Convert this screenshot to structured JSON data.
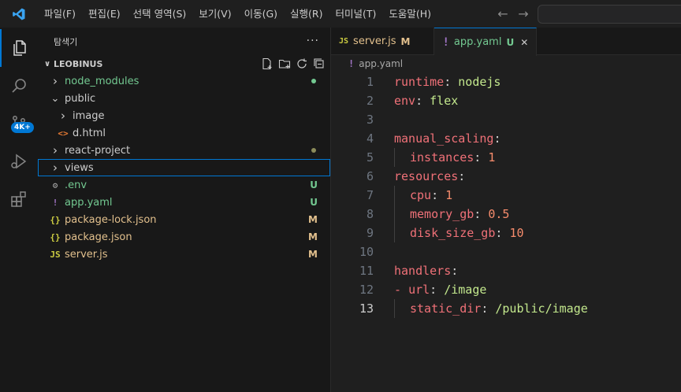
{
  "menu": [
    "파일(F)",
    "편집(E)",
    "선택 영역(S)",
    "보기(V)",
    "이동(G)",
    "실행(R)",
    "터미널(T)",
    "도움말(H)"
  ],
  "nav": {
    "back": "←",
    "forward": "→"
  },
  "activity": {
    "source_control_badge": "4K+"
  },
  "sidebar": {
    "title": "탐색기",
    "more": "···",
    "section": "LEOBINUS",
    "tree": [
      {
        "label": "node_modules",
        "type": "folder",
        "collapsed": true,
        "depth": 0,
        "color": "#73c991",
        "deco_dot": "#73c991"
      },
      {
        "label": "public",
        "type": "folder",
        "collapsed": false,
        "depth": 0,
        "color": "#cccccc"
      },
      {
        "label": "image",
        "type": "folder",
        "collapsed": true,
        "depth": 1,
        "color": "#cccccc"
      },
      {
        "label": "d.html",
        "type": "html",
        "depth": 1,
        "color": "#cccccc"
      },
      {
        "label": "react-project",
        "type": "folder",
        "collapsed": true,
        "depth": 0,
        "color": "#cccccc",
        "deco_dot": "#8c8c5a"
      },
      {
        "label": "views",
        "type": "folder",
        "collapsed": true,
        "depth": 0,
        "color": "#cccccc",
        "focused": true
      },
      {
        "label": ".env",
        "type": "env",
        "depth": 0,
        "color": "#73c991",
        "deco": "U",
        "deco_color": "#73c991"
      },
      {
        "label": "app.yaml",
        "type": "yaml",
        "depth": 0,
        "color": "#73c991",
        "deco": "U",
        "deco_color": "#73c991"
      },
      {
        "label": "package-lock.json",
        "type": "json",
        "depth": 0,
        "color": "#e2c08d",
        "deco": "M",
        "deco_color": "#e2c08d"
      },
      {
        "label": "package.json",
        "type": "json",
        "depth": 0,
        "color": "#e2c08d",
        "deco": "M",
        "deco_color": "#e2c08d"
      },
      {
        "label": "server.js",
        "type": "js",
        "depth": 0,
        "color": "#e2c08d",
        "deco": "M",
        "deco_color": "#e2c08d"
      }
    ]
  },
  "tabs": [
    {
      "label": "server.js",
      "icon": "JS",
      "state": "M",
      "color": "#e2c08d",
      "active": false
    },
    {
      "label": "app.yaml",
      "icon": "!",
      "state": "U",
      "color": "#73c991",
      "active": true
    }
  ],
  "breadcrumb": {
    "icon": "!",
    "file": "app.yaml"
  },
  "code": [
    {
      "n": "1",
      "indent": 0,
      "parts": [
        [
          "k",
          "runtime"
        ],
        [
          "p",
          ": "
        ],
        [
          "v",
          "nodejs"
        ]
      ]
    },
    {
      "n": "2",
      "indent": 0,
      "parts": [
        [
          "k",
          "env"
        ],
        [
          "p",
          ": "
        ],
        [
          "v",
          "flex"
        ]
      ]
    },
    {
      "n": "3",
      "indent": 0,
      "parts": []
    },
    {
      "n": "4",
      "indent": 0,
      "parts": [
        [
          "k",
          "manual_scaling"
        ],
        [
          "p",
          ":"
        ]
      ]
    },
    {
      "n": "5",
      "indent": 1,
      "parts": [
        [
          "k",
          "instances"
        ],
        [
          "p",
          ": "
        ],
        [
          "n",
          "1"
        ]
      ]
    },
    {
      "n": "6",
      "indent": 0,
      "parts": [
        [
          "k",
          "resources"
        ],
        [
          "p",
          ":"
        ]
      ]
    },
    {
      "n": "7",
      "indent": 1,
      "parts": [
        [
          "k",
          "cpu"
        ],
        [
          "p",
          ": "
        ],
        [
          "n",
          "1"
        ]
      ]
    },
    {
      "n": "8",
      "indent": 1,
      "parts": [
        [
          "k",
          "memory_gb"
        ],
        [
          "p",
          ": "
        ],
        [
          "n",
          "0.5"
        ]
      ]
    },
    {
      "n": "9",
      "indent": 1,
      "parts": [
        [
          "k",
          "disk_size_gb"
        ],
        [
          "p",
          ": "
        ],
        [
          "n",
          "10"
        ]
      ]
    },
    {
      "n": "10",
      "indent": 0,
      "parts": []
    },
    {
      "n": "11",
      "indent": 0,
      "parts": [
        [
          "k",
          "handlers"
        ],
        [
          "p",
          ":"
        ]
      ]
    },
    {
      "n": "12",
      "indent": 0,
      "parts": [
        [
          "k",
          "- "
        ],
        [
          "k",
          "url"
        ],
        [
          "p",
          ": "
        ],
        [
          "v",
          "/image"
        ]
      ]
    },
    {
      "n": "13",
      "indent": 1,
      "current": true,
      "parts": [
        [
          "k",
          "static_dir"
        ],
        [
          "p",
          ": "
        ],
        [
          "v",
          "/public/image"
        ]
      ]
    }
  ],
  "colors": {
    "accent": "#0078d4",
    "untracked": "#73c991",
    "modified": "#e2c08d"
  }
}
